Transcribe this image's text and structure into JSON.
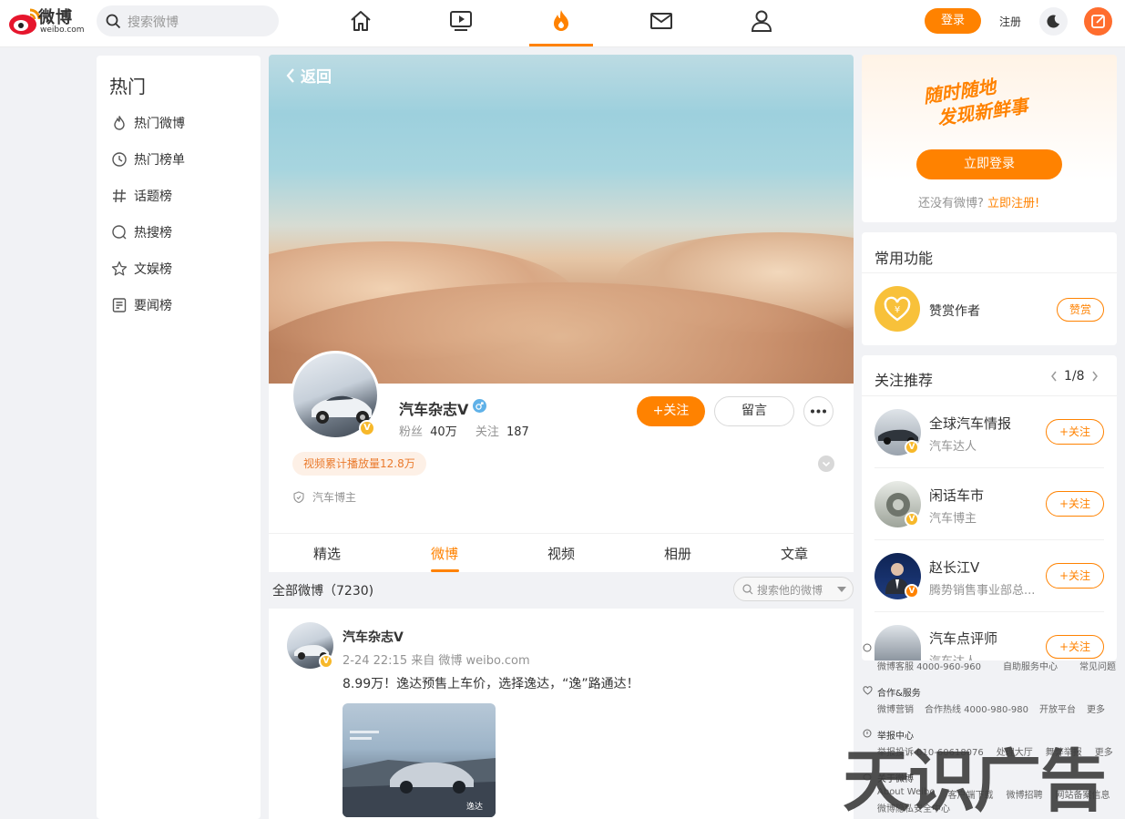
{
  "topbar": {
    "logo_text": "微博",
    "logo_sub": "weibo.com",
    "search_placeholder": "搜索微博",
    "login_label": "登录",
    "register_label": "注册"
  },
  "colors": {
    "accent": "#ff8200",
    "badge_gold": "#f7b82a",
    "background": "#f1f2f5"
  },
  "nav_icons": [
    "home-icon",
    "video-icon",
    "hot-flame-icon",
    "mail-icon",
    "profile-icon"
  ],
  "leftnav": {
    "title": "热门",
    "items": [
      {
        "label": "热门微博",
        "icon": "flame-icon"
      },
      {
        "label": "热门榜单",
        "icon": "clock-icon"
      },
      {
        "label": "话题榜",
        "icon": "hash-icon"
      },
      {
        "label": "热搜榜",
        "icon": "search-hot-icon"
      },
      {
        "label": "文娱榜",
        "icon": "star-icon"
      },
      {
        "label": "要闻榜",
        "icon": "news-icon"
      }
    ]
  },
  "profile": {
    "back_label": "返回",
    "name": "汽车杂志V",
    "fans_label": "粉丝",
    "fans_value": "40万",
    "following_label": "关注",
    "following_value": "187",
    "follow_button": "+关注",
    "message_button": "留言",
    "play_badge": "视频累计播放量12.8万",
    "role": "汽车博主"
  },
  "tabs": [
    "精选",
    "微博",
    "视频",
    "相册",
    "文章"
  ],
  "active_tab": "微博",
  "feed": {
    "count_label": "全部微博（7230)",
    "search_placeholder": "搜索他的微博"
  },
  "post": {
    "author": "汽车杂志V",
    "meta": "2-24 22:15 来自 微博 weibo.com",
    "text": "8.99万！逸达预售上车价，选择逸达，“逸”路通达！",
    "image_caption": "逸达"
  },
  "login_card": {
    "slogan_line1": "随时随地",
    "slogan_line2": "发现新鲜事",
    "login_button": "立即登录",
    "no_account": "还没有微博?",
    "register_now": "立即注册!"
  },
  "features": {
    "title": "常用功能",
    "reward_name": "赞赏作者",
    "reward_button": "赞赏"
  },
  "recommend": {
    "title": "关注推荐",
    "pager": "1/8",
    "items": [
      {
        "name": "全球汽车情报",
        "desc": "汽车达人",
        "button": "+关注"
      },
      {
        "name": "闲话车市",
        "desc": "汽车博主",
        "button": "+关注"
      },
      {
        "name": "赵长江V",
        "desc": "腾势销售事业部总...",
        "button": "+关注"
      },
      {
        "name": "汽车点评师",
        "desc": "汽车达人",
        "button": "+关注"
      }
    ]
  },
  "footer": {
    "row1": [
      "微博客服 4000-960-960",
      "自助服务中心",
      "常见问题"
    ],
    "section2_title": "合作&服务",
    "row2": [
      "微博营销",
      "合作热线 4000-980-980",
      "开放平台",
      "更多"
    ],
    "section3_title": "举报中心",
    "row3": [
      "举报投诉 010-60618076",
      "处理大厅",
      "舞弊举报",
      "更多"
    ],
    "section4_title": "关于微博",
    "row4": [
      "About Weibo",
      "客户端下载",
      "微博招聘",
      "网站备案信息"
    ],
    "row5": "微博隐私安全中心"
  },
  "watermark": "天识广告"
}
